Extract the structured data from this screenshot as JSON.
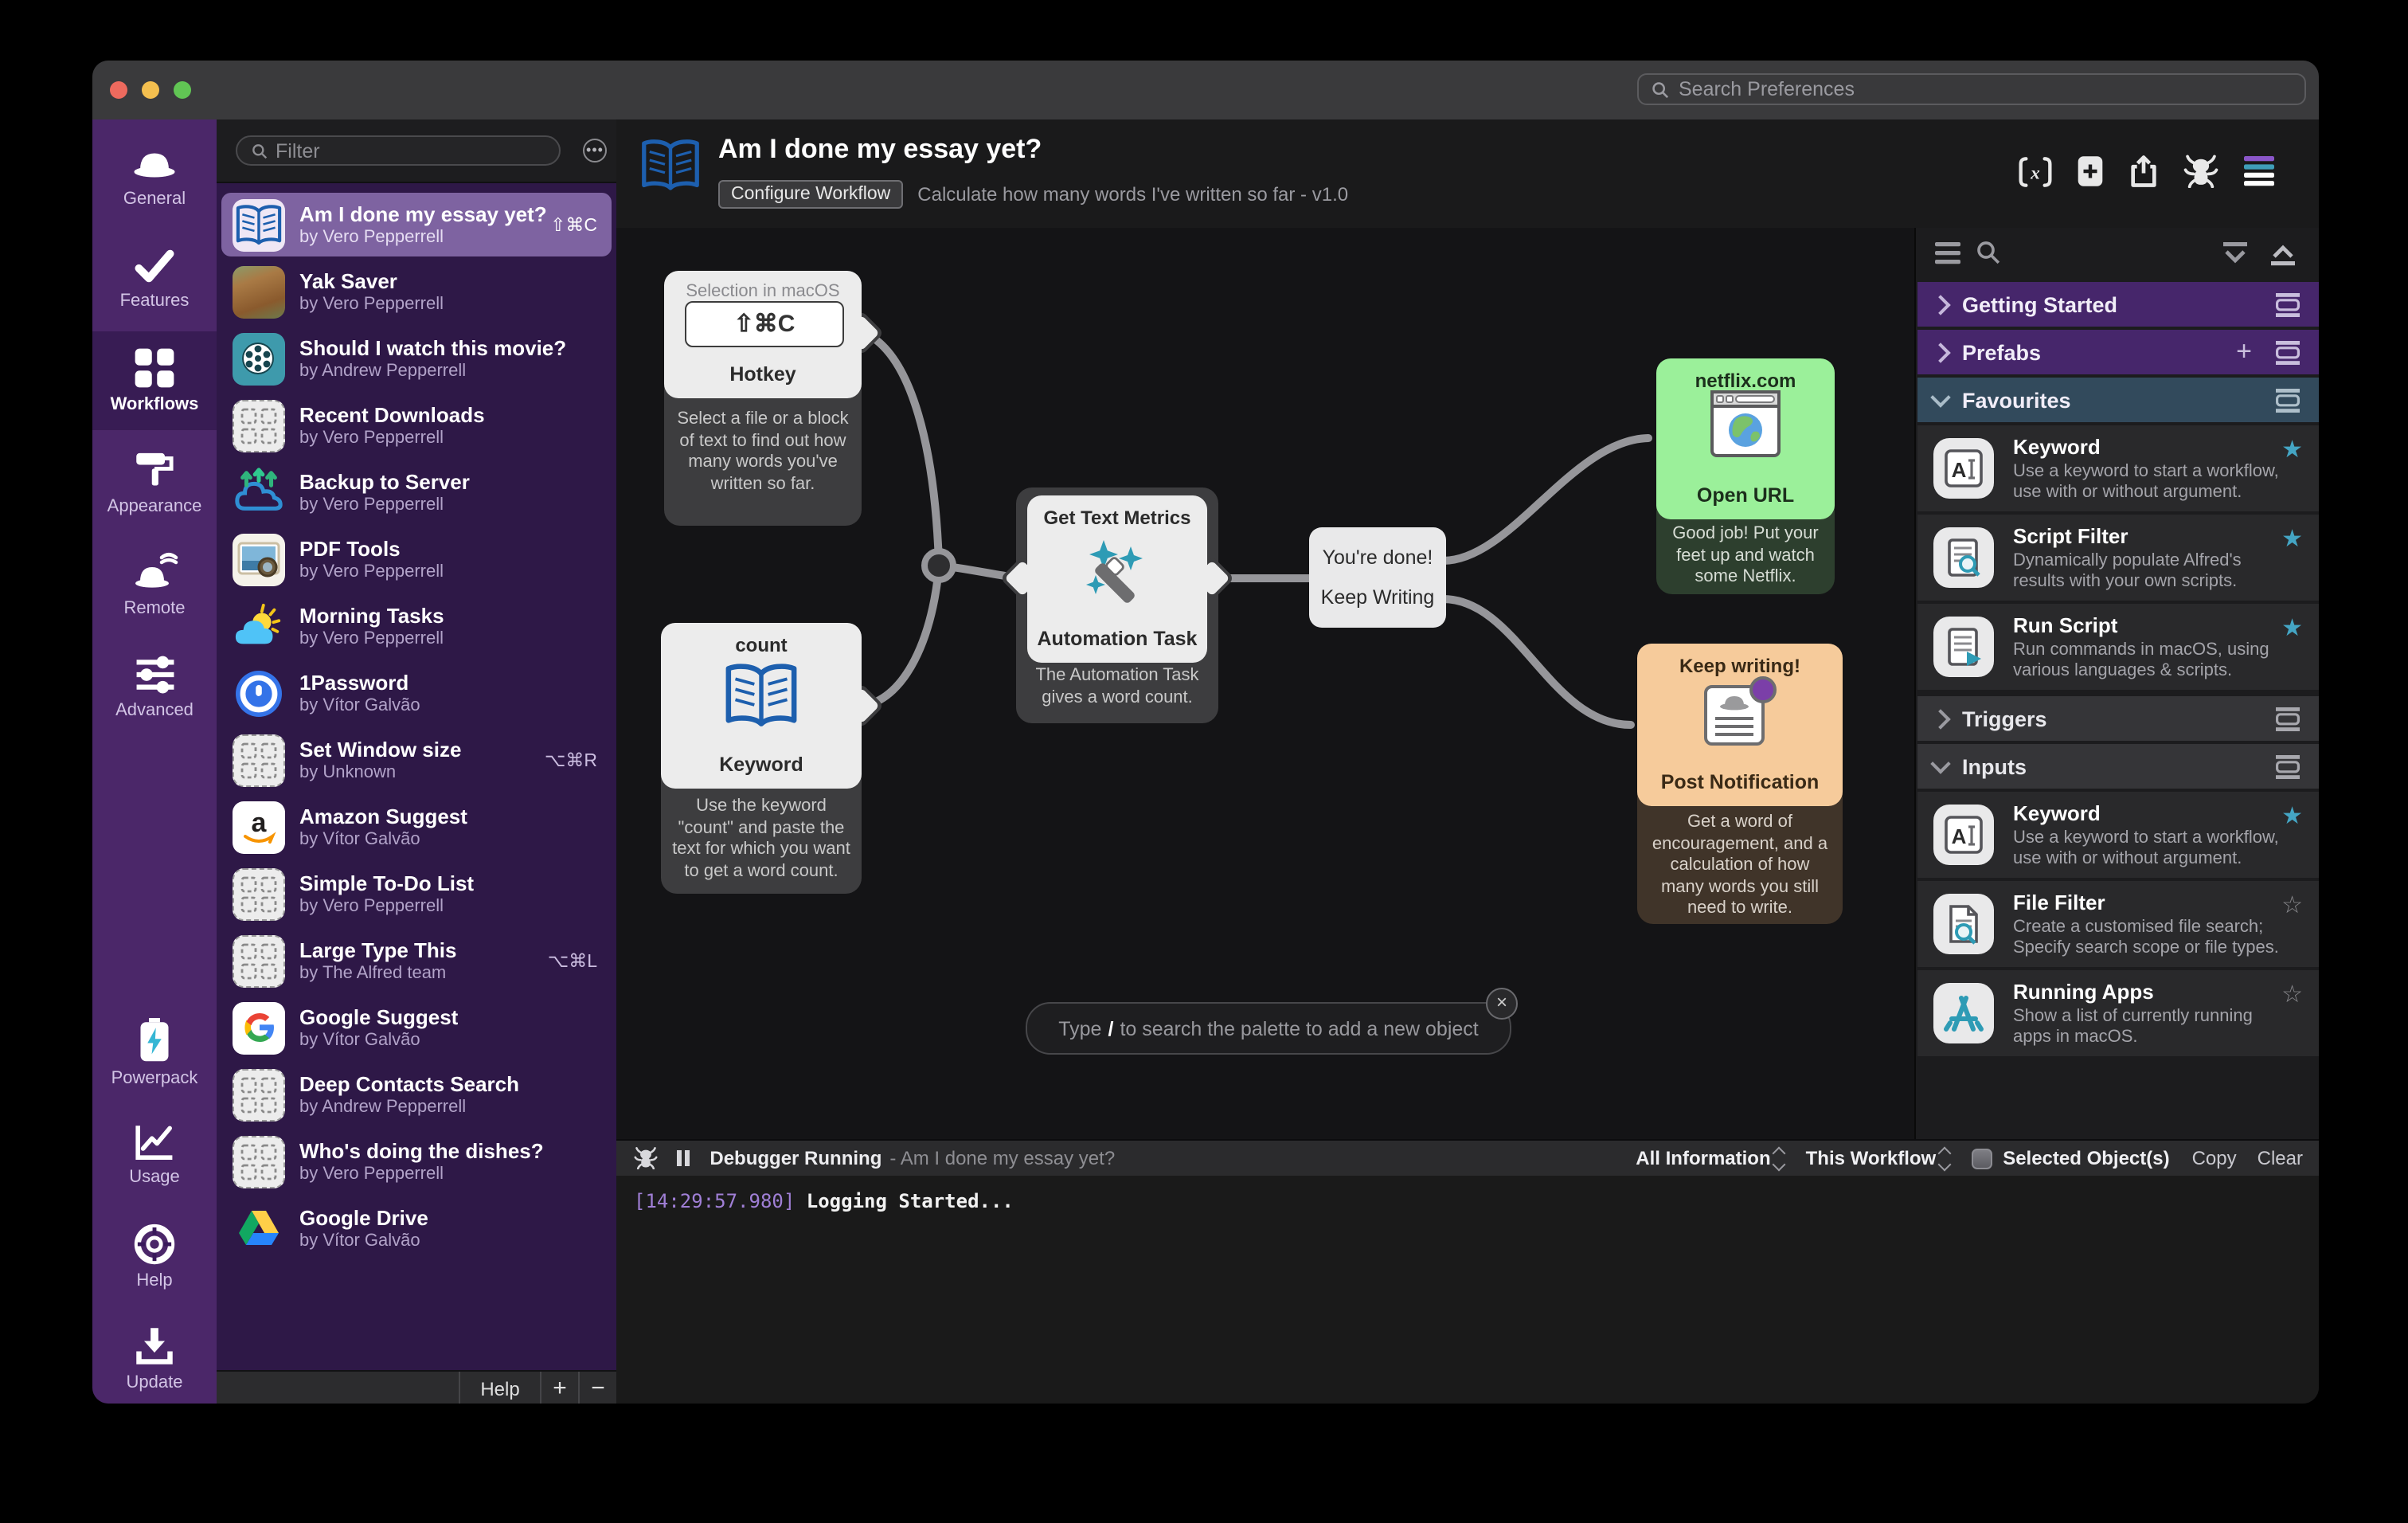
{
  "titlebar": {
    "search_placeholder": "Search Preferences"
  },
  "sidebar": {
    "items": [
      {
        "label": "General"
      },
      {
        "label": "Features"
      },
      {
        "label": "Workflows"
      },
      {
        "label": "Appearance"
      },
      {
        "label": "Remote"
      },
      {
        "label": "Advanced"
      },
      {
        "label": "Powerpack"
      },
      {
        "label": "Usage"
      },
      {
        "label": "Help"
      },
      {
        "label": "Update"
      }
    ]
  },
  "list": {
    "filter_placeholder": "Filter",
    "rows": [
      {
        "title": "Am I done my essay yet?",
        "author": "by Vero Pepperrell",
        "shortcut": "⇧⌘C"
      },
      {
        "title": "Yak Saver",
        "author": "by Vero Pepperrell",
        "shortcut": ""
      },
      {
        "title": "Should I watch this movie?",
        "author": "by Andrew Pepperrell",
        "shortcut": ""
      },
      {
        "title": "Recent Downloads",
        "author": "by Vero Pepperrell",
        "shortcut": ""
      },
      {
        "title": "Backup to Server",
        "author": "by Vero Pepperrell",
        "shortcut": ""
      },
      {
        "title": "PDF Tools",
        "author": "by Vero Pepperrell",
        "shortcut": ""
      },
      {
        "title": "Morning Tasks",
        "author": "by Vero Pepperrell",
        "shortcut": ""
      },
      {
        "title": "1Password",
        "author": "by Vítor Galvão",
        "shortcut": ""
      },
      {
        "title": "Set Window size",
        "author": "by Unknown",
        "shortcut": "⌥⌘R"
      },
      {
        "title": "Amazon Suggest",
        "author": "by Vítor Galvão",
        "shortcut": ""
      },
      {
        "title": "Simple To-Do List",
        "author": "by Vero Pepperrell",
        "shortcut": ""
      },
      {
        "title": "Large Type This",
        "author": "by The Alfred team",
        "shortcut": "⌥⌘L"
      },
      {
        "title": "Google Suggest",
        "author": "by Vítor Galvão",
        "shortcut": ""
      },
      {
        "title": "Deep Contacts Search",
        "author": "by Andrew Pepperrell",
        "shortcut": ""
      },
      {
        "title": "Who's doing the dishes?",
        "author": "by Vero Pepperrell",
        "shortcut": ""
      },
      {
        "title": "Google Drive",
        "author": "by Vítor Galvão",
        "shortcut": ""
      }
    ],
    "footer": {
      "help": "Help",
      "add": "+",
      "remove": "−"
    }
  },
  "header": {
    "title": "Am I done my essay yet?",
    "configure": "Configure Workflow",
    "subtitle": "Calculate how many words I've written so far - v1.0"
  },
  "canvas": {
    "hotkey": {
      "top": "Selection in macOS",
      "key": "⇧⌘C",
      "label": "Hotkey",
      "desc": "Select a file or a block of text to find out how many words you've written so far."
    },
    "keyword": {
      "top": "count",
      "label": "Keyword",
      "desc": "Use the keyword \"count\" and paste the text for which you want to get a word count."
    },
    "automation": {
      "top": "Get Text Metrics",
      "label": "Automation Task",
      "desc": "The Automation Task gives a word count."
    },
    "condition": {
      "line1": "You're done!",
      "line2": "Keep Writing"
    },
    "openurl": {
      "top": "netflix.com",
      "label": "Open URL",
      "desc": "Good job! Put your feet up and watch some Netflix."
    },
    "notification": {
      "top": "Keep writing!",
      "label": "Post Notification",
      "desc": "Get a word of encouragement, and a calculation of how many words you still need to write."
    },
    "palette_search": {
      "pre": "Type",
      "slash": "/",
      "post": "to search the palette to add a new object",
      "close": "×"
    }
  },
  "palette": {
    "sections": {
      "getting_started": "Getting Started",
      "prefabs": "Prefabs",
      "favourites": "Favourites",
      "triggers": "Triggers",
      "inputs": "Inputs"
    },
    "items": [
      {
        "name": "Keyword",
        "desc": "Use a keyword to start a workflow, use with or without argument."
      },
      {
        "name": "Script Filter",
        "desc": "Dynamically populate Alfred's results with your own scripts."
      },
      {
        "name": "Run Script",
        "desc": "Run commands in macOS, using various languages & scripts."
      },
      {
        "name": "Keyword",
        "desc": "Use a keyword to start a workflow, use with or without argument."
      },
      {
        "name": "File Filter",
        "desc": "Create a customised file search; Specify search scope or file types."
      },
      {
        "name": "Running Apps",
        "desc": "Show a list of currently running apps in macOS."
      }
    ],
    "stars": {
      "on": "★",
      "off": "☆"
    },
    "plus": "+"
  },
  "debugger": {
    "status": "Debugger Running",
    "suffix": "- Am I done my essay yet?",
    "filter_info": "All Information",
    "filter_scope": "This Workflow",
    "selected_objects": "Selected Object(s)",
    "copy": "Copy",
    "clear": "Clear",
    "log_time": "[14:29:57.980]",
    "log_text": "Logging Started..."
  }
}
